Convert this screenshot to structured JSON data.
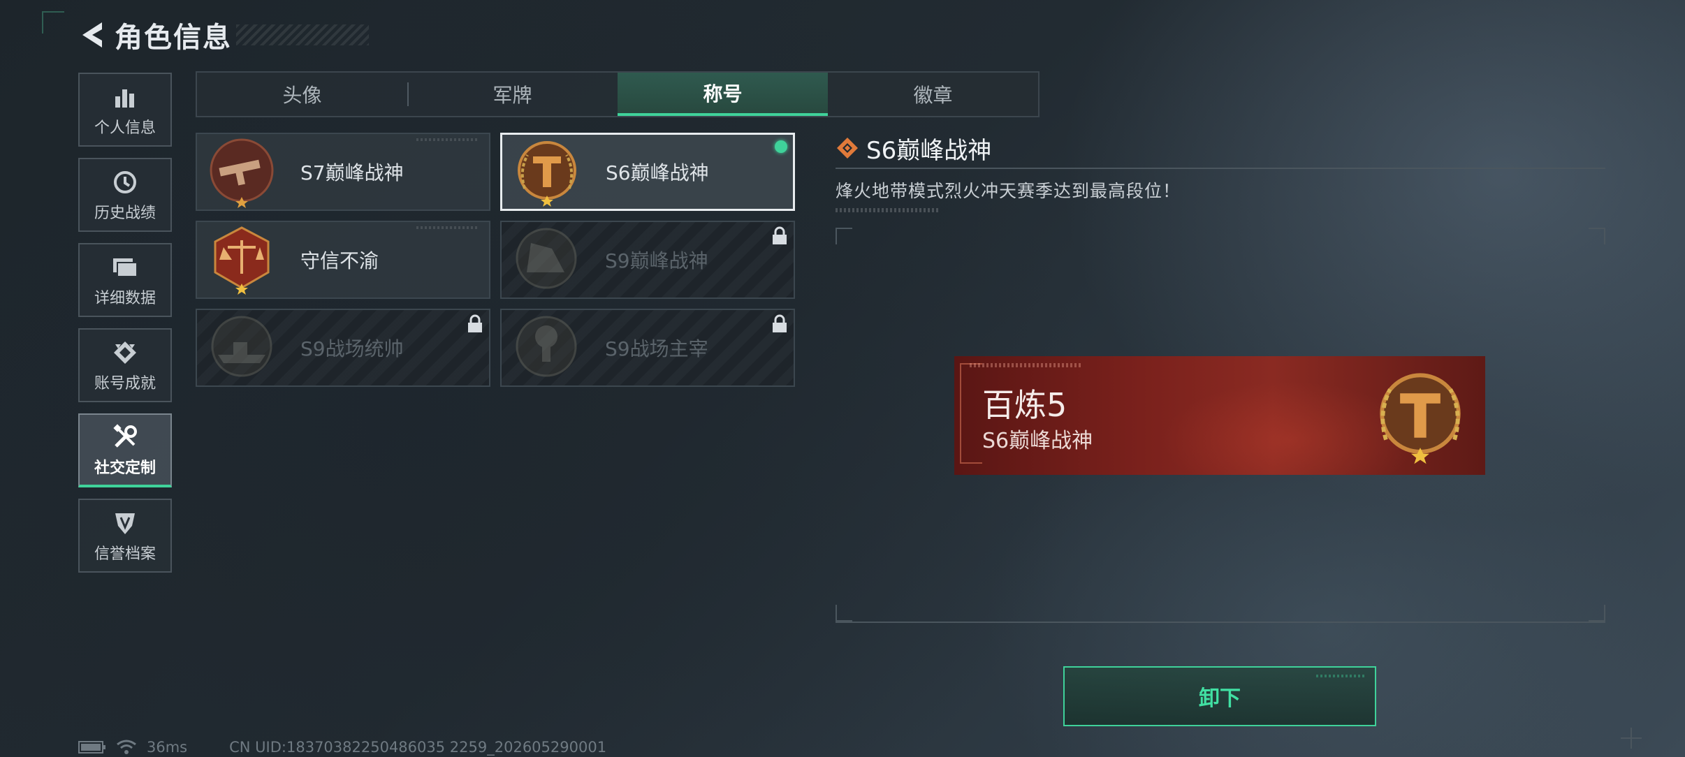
{
  "header": {
    "title": "角色信息"
  },
  "sidebar": {
    "items": [
      {
        "label": "个人信息",
        "icon": "bar-chart-icon"
      },
      {
        "label": "历史战绩",
        "icon": "history-clock-icon"
      },
      {
        "label": "详细数据",
        "icon": "folder-data-icon"
      },
      {
        "label": "账号成就",
        "icon": "achievement-icon"
      },
      {
        "label": "社交定制",
        "icon": "tools-icon"
      },
      {
        "label": "信誉档案",
        "icon": "credit-shield-icon"
      }
    ],
    "active_index": 4
  },
  "tabs": [
    "头像",
    "军牌",
    "称号",
    "徽章"
  ],
  "active_tab": "称号",
  "titles": [
    {
      "name": "S7巅峰战神",
      "locked": false
    },
    {
      "name": "S6巅峰战神",
      "locked": false,
      "selected": true,
      "equipped": true
    },
    {
      "name": "守信不渝",
      "locked": false
    },
    {
      "name": "S9巅峰战神",
      "locked": true
    },
    {
      "name": "S9战场统帅",
      "locked": true
    },
    {
      "name": "S9战场主宰",
      "locked": true
    }
  ],
  "detail": {
    "title": "S6巅峰战神",
    "description": "烽火地带模式烈火冲天赛季达到最高段位！"
  },
  "banner": {
    "main": "百炼5",
    "sub": "S6巅峰战神"
  },
  "action": {
    "label": "卸下"
  },
  "status": {
    "ping": "36ms",
    "uid": "CN UID:18370382250486035 2259_202605290001"
  },
  "colors": {
    "accent": "#3fd29a",
    "banner_red": "#7a211c",
    "emblem_bronze": "#c9873d"
  }
}
